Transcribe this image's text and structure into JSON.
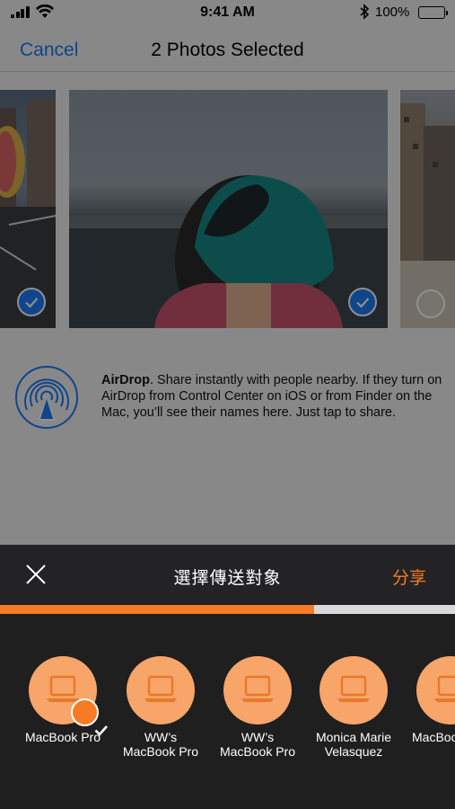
{
  "status_bar": {
    "time": "9:41 AM",
    "battery": "100%"
  },
  "nav": {
    "cancel": "Cancel",
    "title": "2 Photos Selected"
  },
  "photos": [
    {
      "selected": true
    },
    {
      "selected": true
    },
    {
      "selected": false
    }
  ],
  "airdrop": {
    "title": "AirDrop",
    "text": ". Share instantly with people nearby. If they turn on AirDrop from Control Center on iOS or from Finder on the Mac, you’ll see their names here. Just tap to share."
  },
  "panel": {
    "title": "選擇傳送對象",
    "share": "分享",
    "progress": 0.69,
    "accent": "#f77b22"
  },
  "devices": [
    {
      "name": "MacBook Pro",
      "selected": true
    },
    {
      "name": "WW’s\nMacBook Pro",
      "selected": false
    },
    {
      "name": "WW’s\nMacBook Pro",
      "selected": false
    },
    {
      "name": "Monica Marie\nVelasquez",
      "selected": false
    },
    {
      "name": "MacBoo",
      "selected": false
    }
  ]
}
